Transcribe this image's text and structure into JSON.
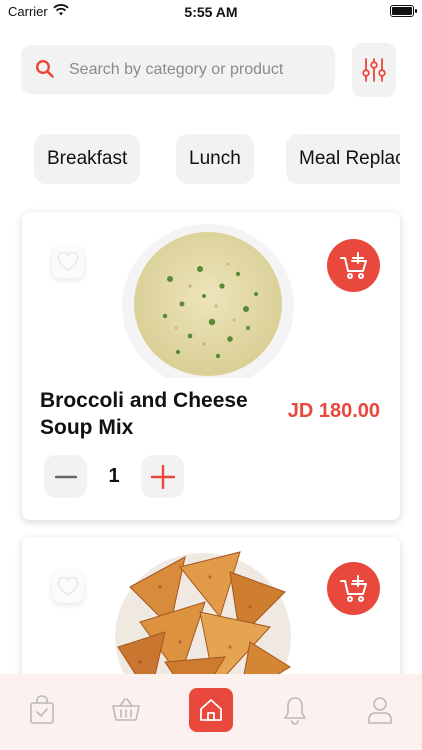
{
  "status_bar": {
    "carrier": "Carrier",
    "time": "5:55 AM"
  },
  "search": {
    "placeholder": "Search by category or product",
    "icon": "search-icon"
  },
  "filter": {
    "icon": "sliders-icon"
  },
  "categories": [
    "Breakfast",
    "Lunch",
    "Meal Replacement"
  ],
  "products": [
    {
      "name": "Broccoli and Cheese Soup Mix",
      "price": "JD 180.00",
      "quantity": "1",
      "image": "broccoli-cheese-soup"
    },
    {
      "image": "tortilla-chips"
    }
  ],
  "bottom_nav": [
    "orders-bag-icon",
    "basket-icon",
    "home-icon",
    "bell-icon",
    "profile-icon"
  ],
  "colors": {
    "accent": "#e8493c",
    "chip_bg": "#f2f2f2",
    "nav_bg": "#fdf1ef"
  }
}
